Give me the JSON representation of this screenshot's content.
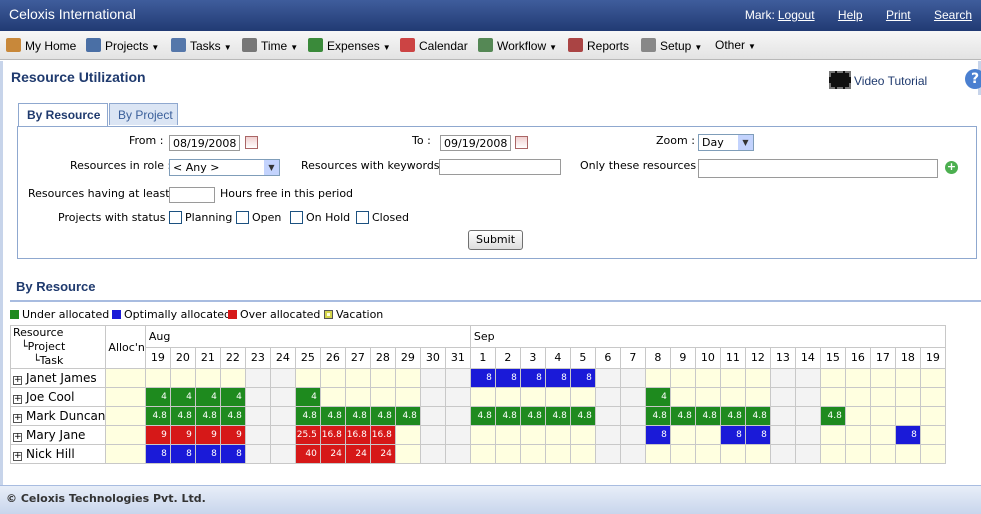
{
  "app": {
    "title": "Celoxis International"
  },
  "toplinks": {
    "user": "Mark:",
    "logout": "Logout",
    "help": "Help",
    "print": "Print",
    "search": "Search"
  },
  "menu": [
    {
      "label": "My Home",
      "icon": "home-icon",
      "dropdown": false,
      "color": "#c8883a"
    },
    {
      "label": "Projects",
      "icon": "projects-icon",
      "dropdown": true,
      "color": "#4a6fa5"
    },
    {
      "label": "Tasks",
      "icon": "checkmark-icon",
      "dropdown": true,
      "color": "#5577aa"
    },
    {
      "label": "Time",
      "icon": "clock-icon",
      "dropdown": true,
      "color": "#777777"
    },
    {
      "label": "Expenses",
      "icon": "money-icon",
      "dropdown": true,
      "color": "#3a8a3a"
    },
    {
      "label": "Calendar",
      "icon": "calendar-icon",
      "dropdown": false,
      "color": "#cc4444"
    },
    {
      "label": "Workflow",
      "icon": "workflow-icon",
      "dropdown": true,
      "color": "#558855"
    },
    {
      "label": "Reports",
      "icon": "reports-icon",
      "dropdown": false,
      "color": "#aa4444"
    },
    {
      "label": "Setup",
      "icon": "tools-icon",
      "dropdown": true,
      "color": "#888888"
    },
    {
      "label": "Other",
      "icon": "",
      "dropdown": true,
      "color": ""
    }
  ],
  "page": {
    "title": "Resource Utilization",
    "video": "Video Tutorial",
    "help": "?"
  },
  "tabs": [
    {
      "label": "By Resource"
    },
    {
      "label": "By Project"
    }
  ],
  "form": {
    "from_label": "From :",
    "from_value": "08/19/2008",
    "to_label": "To :",
    "to_value": "09/19/2008",
    "zoom_label": "Zoom :",
    "zoom_value": "Day",
    "role_label": "Resources in role :",
    "role_value": "< Any >",
    "keywords_label": "Resources with keywords :",
    "keywords_value": "",
    "only_label": "Only these resources :",
    "only_value": "",
    "hours_label": "Resources having at least :",
    "hours_value": "",
    "hours_suffix": "Hours free in this period",
    "status_label": "Projects with status :",
    "statuses": [
      "Planning",
      "Open",
      "On Hold",
      "Closed"
    ],
    "submit": "Submit"
  },
  "section": {
    "title": "By Resource"
  },
  "legend": [
    {
      "label": "Under allocated",
      "color": "#1e8a1e"
    },
    {
      "label": "Optimally allocated",
      "color": "#1a1ad8"
    },
    {
      "label": "Over allocated",
      "color": "#d61818"
    },
    {
      "label": "Vacation",
      "color": "#d4d44a"
    }
  ],
  "grid": {
    "header_resource": "Resource",
    "header_project": "Project",
    "header_task": "Task",
    "header_alloc": "Alloc'n",
    "months": [
      {
        "label": "Aug",
        "span": 13
      },
      {
        "label": "Sep",
        "span": 19
      }
    ],
    "days": [
      "19",
      "20",
      "21",
      "22",
      "23",
      "24",
      "25",
      "26",
      "27",
      "28",
      "29",
      "30",
      "31",
      "1",
      "2",
      "3",
      "4",
      "5",
      "6",
      "7",
      "8",
      "9",
      "10",
      "11",
      "12",
      "13",
      "14",
      "15",
      "16",
      "17",
      "18",
      "19"
    ],
    "weekend_indices": [
      4,
      5,
      11,
      12,
      18,
      19,
      25,
      26
    ],
    "rows": [
      {
        "name": "Janet James",
        "cells": {
          "13": [
            "8",
            "b"
          ],
          "14": [
            "8",
            "b"
          ],
          "15": [
            "8",
            "b"
          ],
          "16": [
            "8",
            "b"
          ],
          "17": [
            "8",
            "b"
          ]
        }
      },
      {
        "name": "Joe Cool",
        "cells": {
          "0": [
            "4",
            "g"
          ],
          "1": [
            "4",
            "g"
          ],
          "2": [
            "4",
            "g"
          ],
          "3": [
            "4",
            "g"
          ],
          "6": [
            "4",
            "g"
          ],
          "20": [
            "4",
            "g"
          ]
        }
      },
      {
        "name": "Mark Duncan",
        "cells": {
          "0": [
            "4.8",
            "g"
          ],
          "1": [
            "4.8",
            "g"
          ],
          "2": [
            "4.8",
            "g"
          ],
          "3": [
            "4.8",
            "g"
          ],
          "6": [
            "4.8",
            "g"
          ],
          "7": [
            "4.8",
            "g"
          ],
          "8": [
            "4.8",
            "g"
          ],
          "9": [
            "4.8",
            "g"
          ],
          "10": [
            "4.8",
            "g"
          ],
          "13": [
            "4.8",
            "g"
          ],
          "14": [
            "4.8",
            "g"
          ],
          "15": [
            "4.8",
            "g"
          ],
          "16": [
            "4.8",
            "g"
          ],
          "17": [
            "4.8",
            "g"
          ],
          "20": [
            "4.8",
            "g"
          ],
          "21": [
            "4.8",
            "g"
          ],
          "22": [
            "4.8",
            "g"
          ],
          "23": [
            "4.8",
            "g"
          ],
          "24": [
            "4.8",
            "g"
          ],
          "27": [
            "4.8",
            "g"
          ]
        }
      },
      {
        "name": "Mary Jane",
        "cells": {
          "0": [
            "9",
            "r"
          ],
          "1": [
            "9",
            "r"
          ],
          "2": [
            "9",
            "r"
          ],
          "3": [
            "9",
            "r"
          ],
          "6": [
            "25.5",
            "r"
          ],
          "7": [
            "16.8",
            "r"
          ],
          "8": [
            "16.8",
            "r"
          ],
          "9": [
            "16.8",
            "r"
          ],
          "20": [
            "8",
            "b"
          ],
          "23": [
            "8",
            "b"
          ],
          "24": [
            "8",
            "b"
          ],
          "30": [
            "8",
            "b"
          ]
        }
      },
      {
        "name": "Nick Hill",
        "cells": {
          "0": [
            "8",
            "b"
          ],
          "1": [
            "8",
            "b"
          ],
          "2": [
            "8",
            "b"
          ],
          "3": [
            "8",
            "b"
          ],
          "6": [
            "40",
            "r"
          ],
          "7": [
            "24",
            "r"
          ],
          "8": [
            "24",
            "r"
          ],
          "9": [
            "24",
            "r"
          ]
        }
      }
    ]
  },
  "footer": {
    "text": "© Celoxis Technologies Pvt. Ltd."
  }
}
